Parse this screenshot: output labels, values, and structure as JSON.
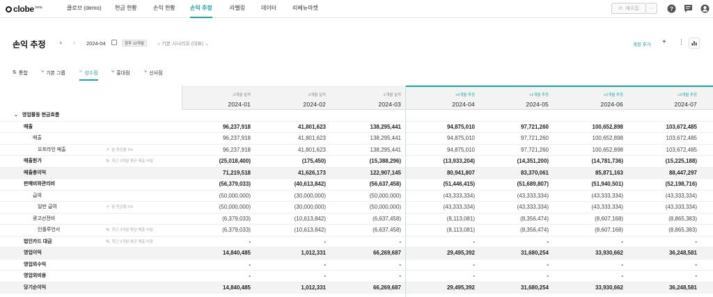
{
  "app": {
    "logo_text": "clobe",
    "logo_badge": "beta"
  },
  "nav": {
    "items": [
      "클로브 (demo)",
      "현금 현황",
      "손익 현황",
      "손익 추정",
      "라벨링",
      "데이터",
      "리베뉴마켓"
    ],
    "active_index": 3,
    "refresh_label": "재수집"
  },
  "header": {
    "title": "손익 추정",
    "date": "2024-04",
    "period_badge": "향후 12개월",
    "scenario": "기본 시나리오 (대표)",
    "add_account": "계정 추가"
  },
  "tabs": {
    "items": [
      "통합",
      "기본 그룹",
      "성수점",
      "홍대점",
      "신사점"
    ],
    "active_index": 2
  },
  "table": {
    "columns": [
      {
        "sub": "-3개월 실적",
        "date": "2024-01",
        "projection": false
      },
      {
        "sub": "-2개월 실적",
        "date": "2024-02",
        "projection": false
      },
      {
        "sub": "-1개월 실적",
        "date": "2024-03",
        "projection": false
      },
      {
        "sub": "+0개월 추정",
        "date": "2024-04",
        "projection": true
      },
      {
        "sub": "+1개월 추정",
        "date": "2024-05",
        "projection": true
      },
      {
        "sub": "+2개월 추정",
        "date": "2024-06",
        "projection": true
      },
      {
        "sub": "+3개월 추정",
        "date": "2024-07",
        "projection": true
      }
    ],
    "section_label": "영업활동 현금흐름",
    "rows": [
      {
        "label": "매출",
        "level": 1,
        "bold": true,
        "shade": false,
        "note": "",
        "values": [
          "96,237,918",
          "41,801,623",
          "138,295,441",
          "94,875,010",
          "97,721,260",
          "100,652,898",
          "103,672,485"
        ]
      },
      {
        "label": "매출",
        "level": 2,
        "bold": false,
        "shade": false,
        "note": "",
        "values": [
          "96,237,918",
          "41,801,623",
          "138,295,441",
          "94,875,010",
          "97,721,260",
          "100,652,898",
          "103,672,485"
        ]
      },
      {
        "label": "오프라인 매출",
        "level": 3,
        "bold": false,
        "shade": false,
        "note": "월 증감율 3%",
        "note_icon": "↗",
        "values": [
          "96,237,918",
          "41,801,623",
          "138,295,441",
          "94,875,010",
          "97,721,260",
          "100,652,898",
          "103,672,485"
        ]
      },
      {
        "label": "매출원가",
        "level": 1,
        "bold": true,
        "shade": false,
        "note": "최근 3개월 평균 매출 비중",
        "note_icon": "%",
        "values": [
          "(25,018,400)",
          "(175,450)",
          "(15,388,296)",
          "(13,933,204)",
          "(14,351,200)",
          "(14,781,736)",
          "(15,225,188)"
        ]
      },
      {
        "label": "매출총이익",
        "level": 1,
        "bold": true,
        "shade": true,
        "note": "",
        "values": [
          "71,219,518",
          "41,626,173",
          "122,907,145",
          "80,941,807",
          "83,370,061",
          "85,871,163",
          "88,447,297"
        ]
      },
      {
        "label": "판매비와관리비",
        "level": 1,
        "bold": true,
        "shade": false,
        "note": "",
        "values": [
          "(56,379,033)",
          "(40,613,842)",
          "(56,637,458)",
          "(51,446,415)",
          "(51,689,807)",
          "(51,940,501)",
          "(52,198,716)"
        ]
      },
      {
        "label": "급여",
        "level": 2,
        "bold": false,
        "shade": false,
        "note": "",
        "values": [
          "(50,000,000)",
          "(30,000,000)",
          "(50,000,000)",
          "(43,333,334)",
          "(43,333,334)",
          "(43,333,334)",
          "(43,333,334)"
        ]
      },
      {
        "label": "일반 급여",
        "level": 3,
        "bold": false,
        "shade": false,
        "note": "월 증감율 0%",
        "note_icon": "↗",
        "values": [
          "(50,000,000)",
          "(30,000,000)",
          "(50,000,000)",
          "(43,333,334)",
          "(43,333,334)",
          "(43,333,334)",
          "(43,333,334)"
        ]
      },
      {
        "label": "광고선전비",
        "level": 2,
        "bold": false,
        "shade": false,
        "note": "",
        "values": [
          "(6,379,033)",
          "(10,613,842)",
          "(6,637,458)",
          "(8,113,081)",
          "(8,356,474)",
          "(8,607,168)",
          "(8,865,383)"
        ]
      },
      {
        "label": "인플루언서",
        "level": 3,
        "bold": false,
        "shade": false,
        "note": "최근 3개월 평균 매출 비중",
        "note_icon": "%",
        "values": [
          "(6,379,033)",
          "(10,613,842)",
          "(6,637,458)",
          "(8,113,081)",
          "(8,356,474)",
          "(8,607,168)",
          "(8,865,383)"
        ]
      },
      {
        "label": "법인카드 대금",
        "level": 1,
        "bold": true,
        "shade": false,
        "note": "최근 3개월 평균 매출 비중",
        "note_icon": "%",
        "values": [
          "-",
          "-",
          "-",
          "-",
          "-",
          "-",
          "-"
        ]
      },
      {
        "label": "영업이익",
        "level": 1,
        "bold": true,
        "shade": true,
        "note": "",
        "values": [
          "14,840,485",
          "1,012,331",
          "66,269,687",
          "29,495,392",
          "31,680,254",
          "33,930,662",
          "36,248,581"
        ]
      },
      {
        "label": "영업외수익",
        "level": 1,
        "bold": true,
        "shade": false,
        "note": "",
        "values": [
          "-",
          "-",
          "-",
          "-",
          "-",
          "-",
          "-"
        ]
      },
      {
        "label": "영업외비용",
        "level": 1,
        "bold": true,
        "shade": false,
        "note": "",
        "values": [
          "-",
          "-",
          "-",
          "-",
          "-",
          "-",
          "-"
        ]
      },
      {
        "label": "당기순이익",
        "level": 1,
        "bold": true,
        "shade": true,
        "note": "",
        "values": [
          "14,840,485",
          "1,012,331",
          "66,269,687",
          "29,495,392",
          "31,680,254",
          "33,930,662",
          "36,248,581"
        ]
      }
    ]
  },
  "colors": {
    "accent": "#1aa7a2",
    "shade": "#f3f3f3"
  }
}
